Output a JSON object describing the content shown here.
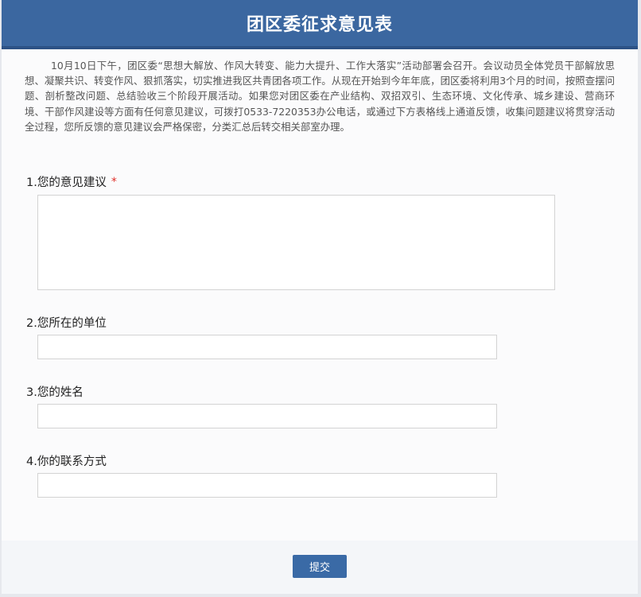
{
  "header": {
    "title": "团区委征求意见表"
  },
  "intro": {
    "text": "10月10日下午，团区委“思想大解放、作风大转变、能力大提升、工作大落实”活动部署会召开。会议动员全体党员干部解放思想、凝聚共识、转变作风、狠抓落实，切实推进我区共青团各项工作。从现在开始到今年年底，团区委将利用3个月的时间，按照查摆问题、剖析整改问题、总结验收三个阶段开展活动。如果您对团区委在产业结构、双招双引、生态环境、文化传承、城乡建设、营商环境、干部作风建设等方面有任何意见建议，可拨打0533-7220353办公电话，或通过下方表格线上通道反馈，收集问题建议将贯穿活动全过程，您所反馈的意见建议会严格保密，分类汇总后转交相关部室办理。"
  },
  "questions": [
    {
      "label": "1.您的意见建议",
      "required_mark": "*",
      "value": ""
    },
    {
      "label": "2.您所在的单位",
      "value": ""
    },
    {
      "label": "3.您的姓名",
      "value": ""
    },
    {
      "label": "4.你的联系方式",
      "value": ""
    }
  ],
  "submit": {
    "label": "提交"
  },
  "colors": {
    "header_bg": "#3b67a0",
    "submit_bg": "#3a6aa6",
    "required": "#e0312b"
  }
}
